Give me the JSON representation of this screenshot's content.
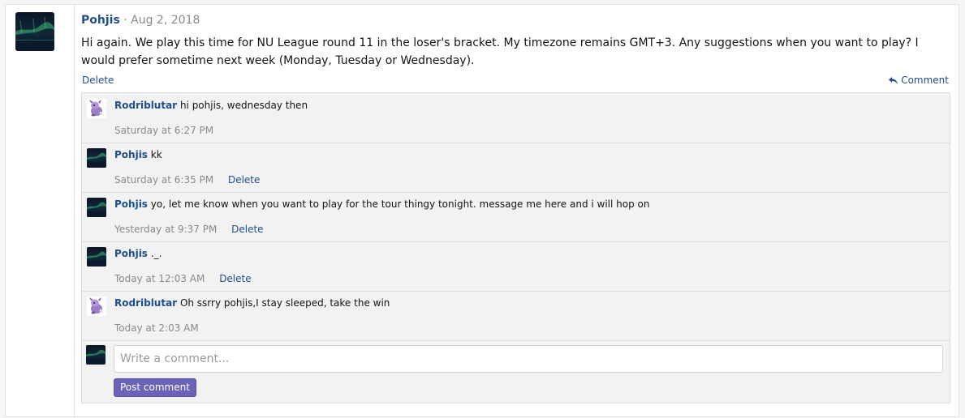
{
  "post": {
    "author": "Pohjis",
    "separator": "·",
    "date": "Aug 2, 2018",
    "body": "Hi again. We play this time for NU League round 11 in the loser's bracket. My timezone remains GMT+3. Any suggestions when you want to play? I would prefer sometime next week (Monday, Tuesday or Wednesday).",
    "delete_label": "Delete",
    "comment_label": "Comment"
  },
  "comments": [
    {
      "author": "Rodriblutar",
      "text": "hi pohjis, wednesday then",
      "time": "Saturday at 6:27 PM",
      "delete_label": ""
    },
    {
      "author": "Pohjis",
      "text": "kk",
      "time": "Saturday at 6:35 PM",
      "delete_label": "Delete"
    },
    {
      "author": "Pohjis",
      "text": "yo, let me know when you want to play for the tour thingy tonight. message me here and i will hop on",
      "time": "Yesterday at 9:37 PM",
      "delete_label": "Delete"
    },
    {
      "author": "Pohjis",
      "text": "._.",
      "time": "Today at 12:03 AM",
      "delete_label": "Delete"
    },
    {
      "author": "Rodriblutar",
      "text": "Oh ssrry pohjis,I stay sleeped, take the win",
      "time": "Today at 2:03 AM",
      "delete_label": ""
    }
  ],
  "composer": {
    "placeholder": "Write a comment...",
    "submit_label": "Post comment"
  },
  "colors": {
    "link": "#1f4e8c",
    "button": "#6b63b8",
    "muted": "#8a8a8a"
  },
  "icons": {
    "comment": "reply-arrow-icon",
    "avatar_pohjis": "aurora-night-avatar",
    "avatar_rodriblutar": "purple-creature-avatar"
  }
}
